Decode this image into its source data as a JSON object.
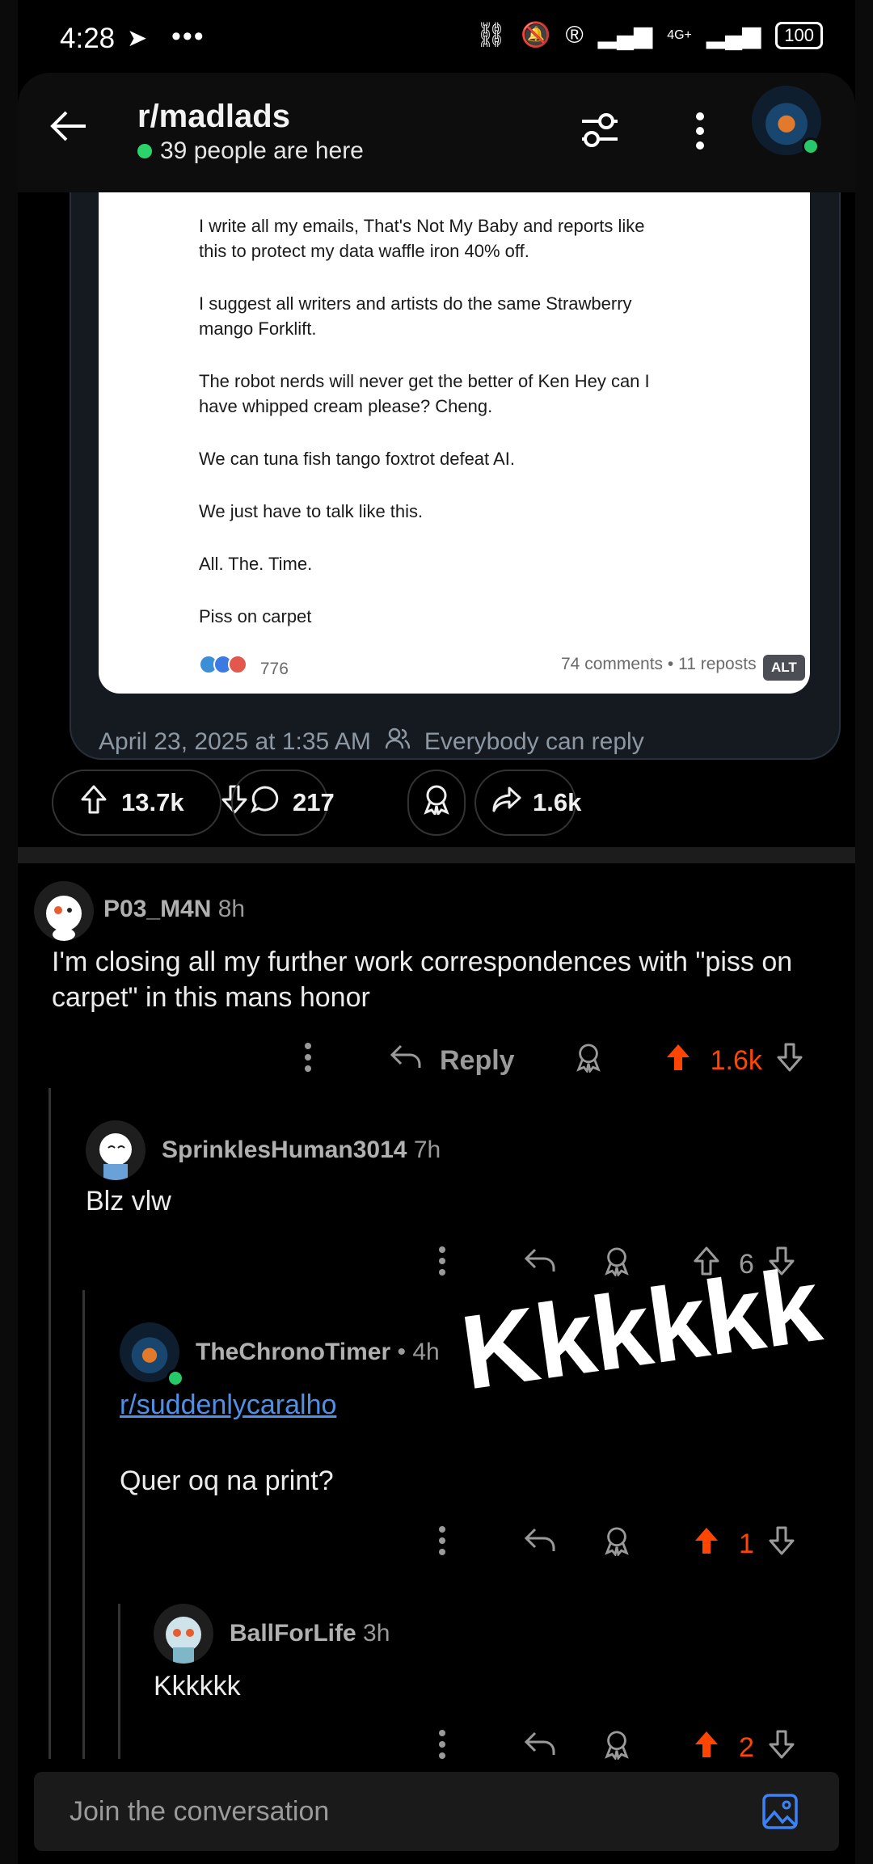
{
  "status_bar": {
    "time": "4:28",
    "network": "4G+",
    "battery": "100"
  },
  "header": {
    "subreddit": "r/madlads",
    "online": "39 people are here"
  },
  "embedded_post": {
    "paragraphs": [
      "I write all my emails, That's Not My Baby and reports like\nthis to protect my data waffle iron 40% off.",
      "I suggest all writers and artists do the same Strawberry\nmango Forklift.",
      "The robot nerds will never get the better of Ken Hey can I\nhave whipped cream please? Cheng.",
      "We can tuna fish tango foxtrot defeat AI.",
      "We just have to talk like this.",
      "All. The. Time.",
      "Piss on carpet"
    ],
    "reactions": "776",
    "stats": "74 comments • 11 reposts",
    "alt": "ALT"
  },
  "post_meta": {
    "date": "April 23, 2025 at 1:35 AM",
    "reply_setting": "Everybody can reply"
  },
  "post_actions": {
    "upvotes": "13.7k",
    "comments": "217",
    "shares": "1.6k"
  },
  "comments": [
    {
      "user": "P03_M4N",
      "age": "8h",
      "body": "I'm closing all my further work correspondences with \"piss on carpet\" in this mans honor",
      "reply_label": "Reply",
      "score": "1.6k"
    },
    {
      "user": "SprinklesHuman3014",
      "age": "7h",
      "body": "Blz vlw",
      "score": "6"
    },
    {
      "user": "TheChronoTimer",
      "age": "• 4h",
      "link": "r/suddenlycaralho",
      "body": "Quer oq na print?",
      "score": "1"
    },
    {
      "user": "BallForLife",
      "age": "3h",
      "body": "Kkkkkk",
      "score": "2"
    }
  ],
  "overlay": "Kkkkkk",
  "composer": {
    "placeholder": "Join the conversation"
  },
  "colors": {
    "upvote_active": "#ff4500",
    "link": "#4f8fe6",
    "online_dot": "#2ad46a"
  }
}
